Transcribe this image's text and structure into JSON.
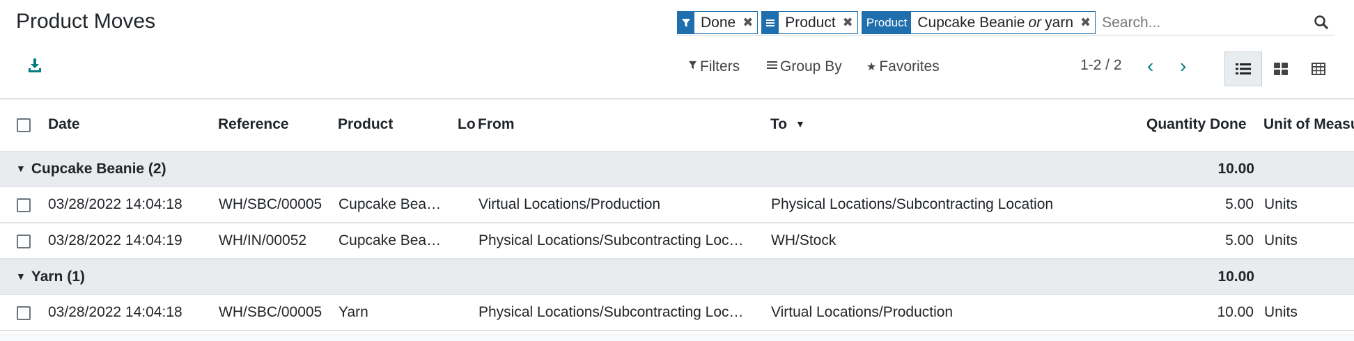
{
  "page": {
    "title": "Product Moves"
  },
  "search": {
    "facets": [
      {
        "icon": "filter-icon",
        "value": "Done"
      },
      {
        "icon": "group-by-icon",
        "value": "Product"
      },
      {
        "label": "Product",
        "value_a": "Cupcake Beanie",
        "connector": "or",
        "value_b": "yarn"
      }
    ],
    "placeholder": "Search..."
  },
  "control_panel": {
    "filters_label": "Filters",
    "groupby_label": "Group By",
    "favorites_label": "Favorites",
    "pager": "1-2 / 2"
  },
  "columns": {
    "date": "Date",
    "reference": "Reference",
    "product": "Product",
    "lot": "Lo",
    "from": "From",
    "to": "To",
    "quantity": "Quantity Done",
    "uom": "Unit of Measu"
  },
  "groups": [
    {
      "label": "Cupcake Beanie (2)",
      "total": "10.00",
      "rows": [
        {
          "date": "03/28/2022 14:04:18",
          "reference": "WH/SBC/00005",
          "product": "Cupcake Bea…",
          "from": "Virtual Locations/Production",
          "to": "Physical Locations/Subcontracting Location",
          "qty": "5.00",
          "uom": "Units"
        },
        {
          "date": "03/28/2022 14:04:19",
          "reference": "WH/IN/00052",
          "product": "Cupcake Bea…",
          "from": "Physical Locations/Subcontracting Loc…",
          "to": "WH/Stock",
          "qty": "5.00",
          "uom": "Units"
        }
      ]
    },
    {
      "label": "Yarn (1)",
      "total": "10.00",
      "rows": [
        {
          "date": "03/28/2022 14:04:18",
          "reference": "WH/SBC/00005",
          "product": "Yarn",
          "from": "Physical Locations/Subcontracting Loc…",
          "to": "Virtual Locations/Production",
          "qty": "10.00",
          "uom": "Units"
        }
      ]
    }
  ],
  "colors": {
    "accent": "#017e84",
    "facet_blue": "#1f6fae",
    "group_bg": "#e9ecef"
  }
}
